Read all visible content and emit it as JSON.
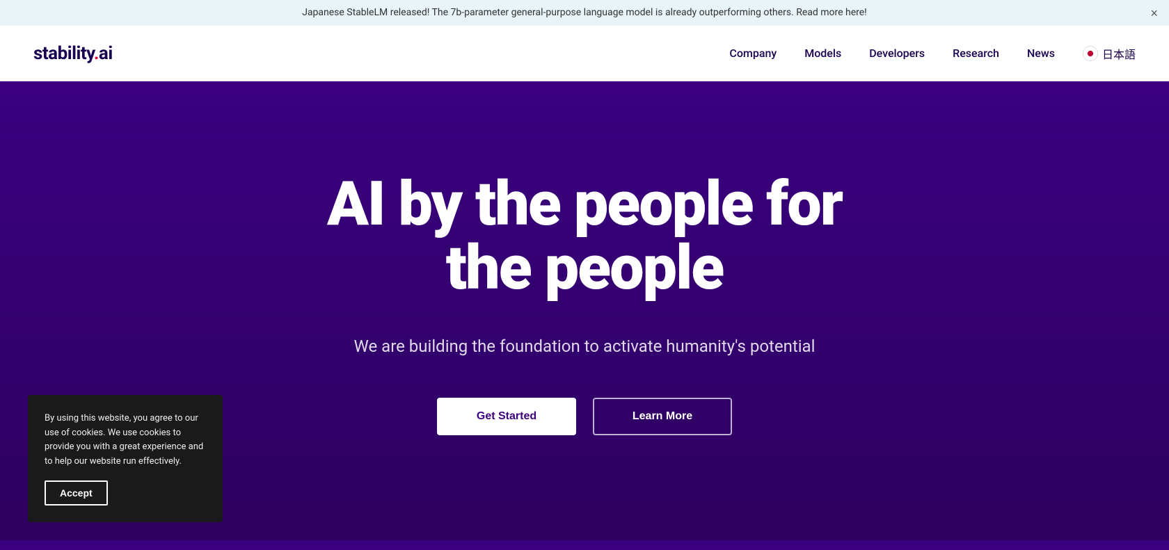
{
  "banner": {
    "text": "Japanese StableLM released! The 7b-parameter general-purpose language model is already outperforming others. Read more here!",
    "close_label": "×"
  },
  "navbar": {
    "logo": {
      "text_before_dot": "stability",
      "dot": ".",
      "text_after_dot": "ai"
    },
    "links": [
      {
        "label": "Company",
        "href": "#"
      },
      {
        "label": "Models",
        "href": "#"
      },
      {
        "label": "Developers",
        "href": "#"
      },
      {
        "label": "Research",
        "href": "#"
      },
      {
        "label": "News",
        "href": "#"
      }
    ],
    "japan_label": "日本語"
  },
  "hero": {
    "title": "AI by the people for the people",
    "subtitle": "We are building the foundation to activate humanity's potential",
    "btn_primary": "Get Started",
    "btn_secondary": "Learn More"
  },
  "cookie": {
    "text": "By using this website, you agree to our use of cookies. We use cookies to provide you with a great experience and to help our website run effectively.",
    "accept_label": "Accept"
  }
}
